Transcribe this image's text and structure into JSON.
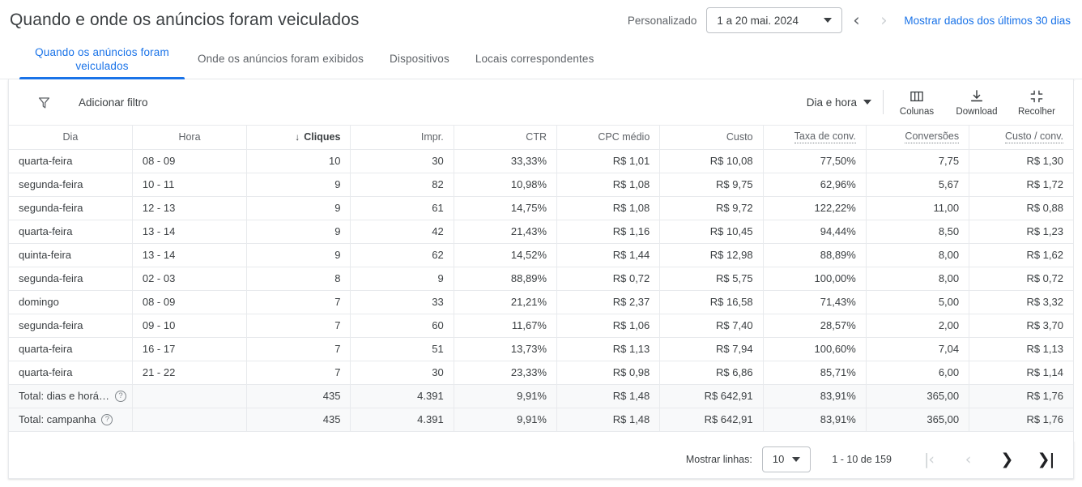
{
  "header": {
    "title": "Quando e onde os anúncios foram veiculados",
    "date_preset_label": "Personalizado",
    "date_range_value": "1 a 20 mai. 2024",
    "prev_arrow": "‹",
    "next_arrow": "›",
    "last30_link": "Mostrar dados dos últimos 30 dias"
  },
  "tabs": [
    {
      "label": "Quando os anúncios foram veiculados",
      "active": true
    },
    {
      "label": "Onde os anúncios foram exibidos",
      "active": false
    },
    {
      "label": "Dispositivos",
      "active": false
    },
    {
      "label": "Locais correspondentes",
      "active": false
    }
  ],
  "toolbar": {
    "filter_icon": "filter-funnel-icon",
    "add_filter_label": "Adicionar filtro",
    "segment_label": "Dia e hora",
    "columns_label": "Colunas",
    "download_label": "Download",
    "collapse_label": "Recolher"
  },
  "table": {
    "columns": [
      {
        "label": "Dia",
        "align": "left",
        "sorted": false,
        "dotted": false
      },
      {
        "label": "Hora",
        "align": "left",
        "sorted": false,
        "dotted": false
      },
      {
        "label": "Cliques",
        "align": "right",
        "sorted": true,
        "sort_dir": "↓",
        "dotted": false
      },
      {
        "label": "Impr.",
        "align": "right",
        "sorted": false,
        "dotted": false
      },
      {
        "label": "CTR",
        "align": "right",
        "sorted": false,
        "dotted": false
      },
      {
        "label": "CPC médio",
        "align": "right",
        "sorted": false,
        "dotted": false
      },
      {
        "label": "Custo",
        "align": "right",
        "sorted": false,
        "dotted": false
      },
      {
        "label": "Taxa de conv.",
        "align": "right",
        "sorted": false,
        "dotted": true
      },
      {
        "label": "Conversões",
        "align": "right",
        "sorted": false,
        "dotted": true
      },
      {
        "label": "Custo / conv.",
        "align": "right",
        "sorted": false,
        "dotted": true
      }
    ],
    "rows": [
      [
        "quarta-feira",
        "08 - 09",
        "10",
        "30",
        "33,33%",
        "R$ 1,01",
        "R$ 10,08",
        "77,50%",
        "7,75",
        "R$ 1,30"
      ],
      [
        "segunda-feira",
        "10 - 11",
        "9",
        "82",
        "10,98%",
        "R$ 1,08",
        "R$ 9,75",
        "62,96%",
        "5,67",
        "R$ 1,72"
      ],
      [
        "segunda-feira",
        "12 - 13",
        "9",
        "61",
        "14,75%",
        "R$ 1,08",
        "R$ 9,72",
        "122,22%",
        "11,00",
        "R$ 0,88"
      ],
      [
        "quarta-feira",
        "13 - 14",
        "9",
        "42",
        "21,43%",
        "R$ 1,16",
        "R$ 10,45",
        "94,44%",
        "8,50",
        "R$ 1,23"
      ],
      [
        "quinta-feira",
        "13 - 14",
        "9",
        "62",
        "14,52%",
        "R$ 1,44",
        "R$ 12,98",
        "88,89%",
        "8,00",
        "R$ 1,62"
      ],
      [
        "segunda-feira",
        "02 - 03",
        "8",
        "9",
        "88,89%",
        "R$ 0,72",
        "R$ 5,75",
        "100,00%",
        "8,00",
        "R$ 0,72"
      ],
      [
        "domingo",
        "08 - 09",
        "7",
        "33",
        "21,21%",
        "R$ 2,37",
        "R$ 16,58",
        "71,43%",
        "5,00",
        "R$ 3,32"
      ],
      [
        "segunda-feira",
        "09 - 10",
        "7",
        "60",
        "11,67%",
        "R$ 1,06",
        "R$ 7,40",
        "28,57%",
        "2,00",
        "R$ 3,70"
      ],
      [
        "quarta-feira",
        "16 - 17",
        "7",
        "51",
        "13,73%",
        "R$ 1,13",
        "R$ 7,94",
        "100,60%",
        "7,04",
        "R$ 1,13"
      ],
      [
        "quarta-feira",
        "21 - 22",
        "7",
        "30",
        "23,33%",
        "R$ 0,98",
        "R$ 6,86",
        "85,71%",
        "6,00",
        "R$ 1,14"
      ]
    ],
    "totals": [
      {
        "label": "Total: dias e horá…",
        "help_icon": "help-circle-icon",
        "values": [
          "",
          "435",
          "4.391",
          "9,91%",
          "R$ 1,48",
          "R$ 642,91",
          "83,91%",
          "365,00",
          "R$ 1,76"
        ]
      },
      {
        "label": "Total: campanha",
        "help_icon": "help-circle-icon",
        "values": [
          "",
          "435",
          "4.391",
          "9,91%",
          "R$ 1,48",
          "R$ 642,91",
          "83,91%",
          "365,00",
          "R$ 1,76"
        ]
      }
    ]
  },
  "footer": {
    "rows_label": "Mostrar linhas:",
    "rows_value": "10",
    "range_text": "1 - 10 de 159",
    "first_page": "|‹",
    "prev_page": "‹",
    "next_page": "❯",
    "last_page": "❯|"
  },
  "colors": {
    "accent": "#1a73e8",
    "text_primary": "#3c4043",
    "text_secondary": "#5f6368",
    "border": "#e8eaed",
    "total_row_bg": "#f8f9fa",
    "page_bg": "#f1f3f4"
  }
}
